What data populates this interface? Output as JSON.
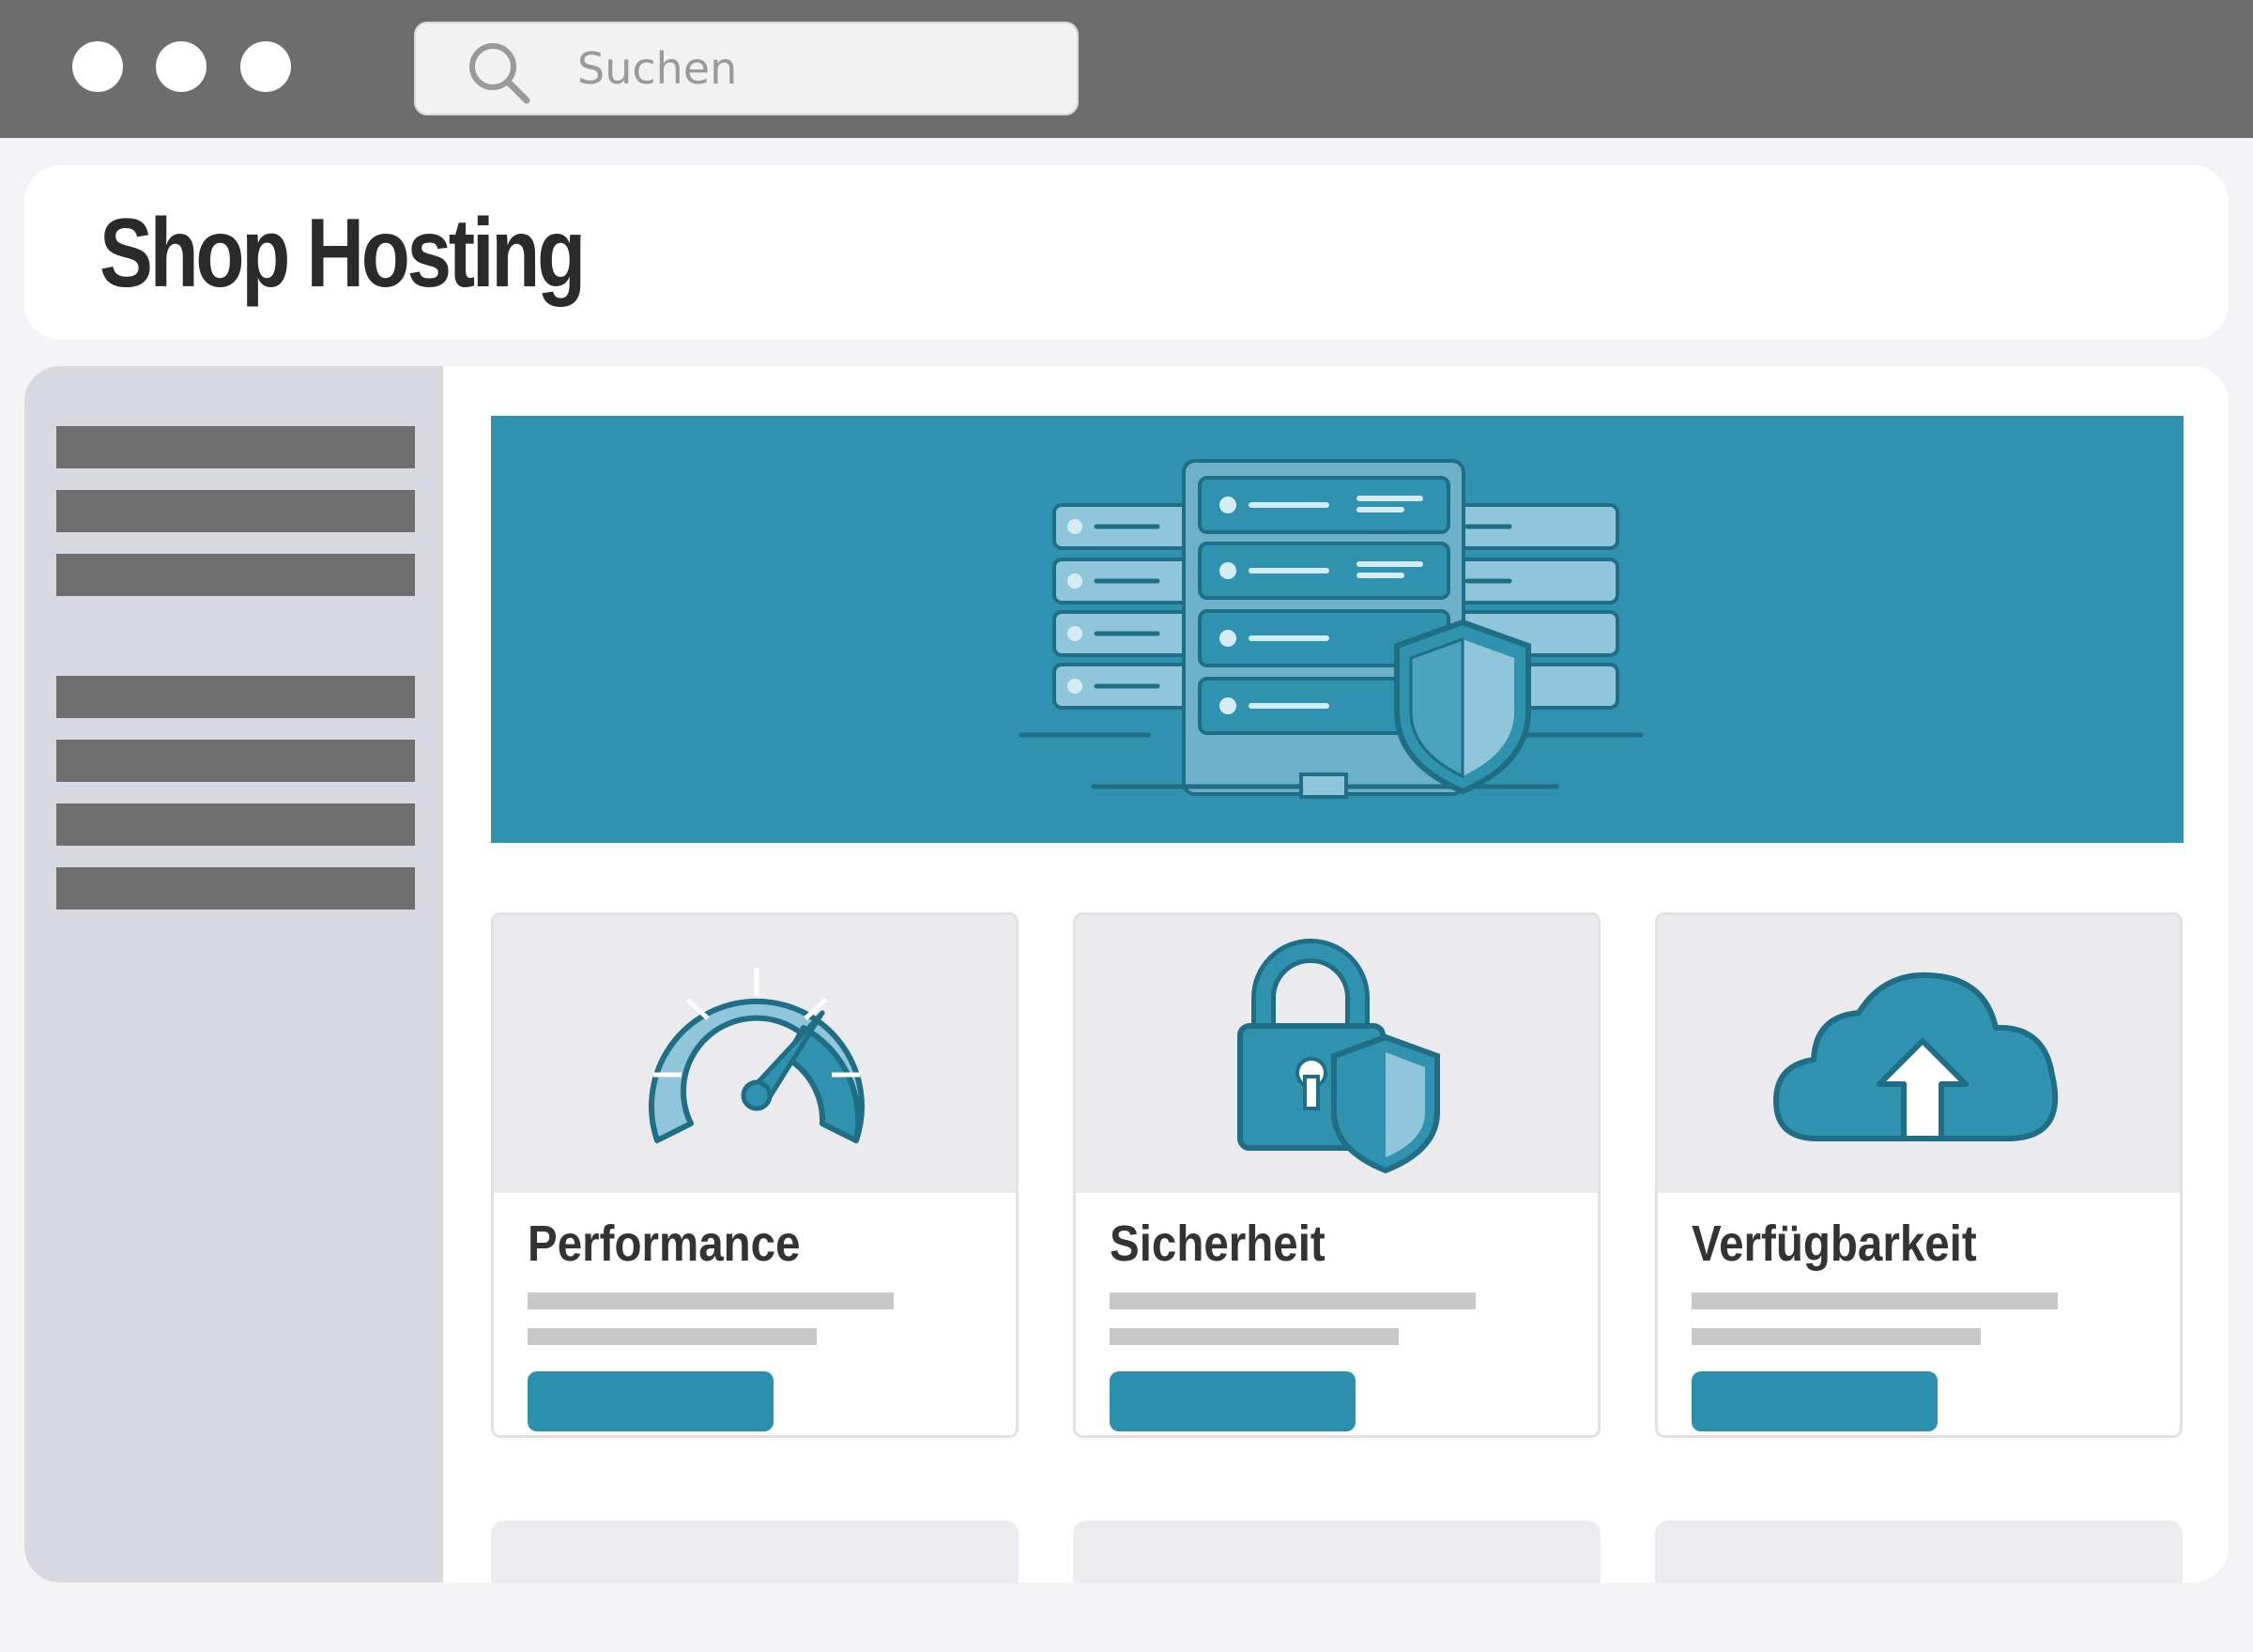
{
  "browser": {
    "search": {
      "placeholder": "Suchen"
    }
  },
  "header": {
    "title": "Shop Hosting"
  },
  "cards": [
    {
      "title": "Performance",
      "icon": "speedometer-icon"
    },
    {
      "title": "Sicherheit",
      "icon": "lock-shield-icon"
    },
    {
      "title": "Verfügbarkeit",
      "icon": "cloud-upload-icon"
    }
  ],
  "hero": {
    "icon": "server-rack-shield-icon"
  },
  "colors": {
    "accent": "#2f93b0",
    "button": "#2b8fae",
    "titlebar": "#6d6d6d",
    "sidebar": "#d8d8e0"
  }
}
